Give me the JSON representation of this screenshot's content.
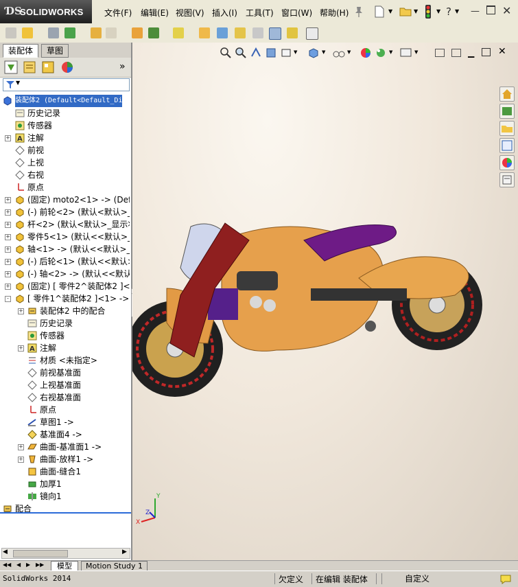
{
  "app": {
    "logo": "SOLIDWORKS",
    "status_version": "SolidWorks 2014"
  },
  "menu": [
    "文件(F)",
    "编辑(E)",
    "视图(V)",
    "插入(I)",
    "工具(T)",
    "窗口(W)",
    "帮助(H)"
  ],
  "panel_tabs": [
    "装配体",
    "草图"
  ],
  "tree": [
    {
      "label": "装配体2  (Default<Default_Di",
      "icon": "assembly-icon",
      "level": 0,
      "expander": ""
    },
    {
      "label": "历史记录",
      "icon": "history-icon",
      "level": 1,
      "expander": ""
    },
    {
      "label": "传感器",
      "icon": "sensor-icon",
      "level": 1,
      "expander": ""
    },
    {
      "label": "注解",
      "icon": "annotation-icon",
      "level": 1,
      "expander": "+"
    },
    {
      "label": "前视",
      "icon": "plane-icon",
      "level": 1,
      "expander": ""
    },
    {
      "label": "上视",
      "icon": "plane-icon",
      "level": 1,
      "expander": ""
    },
    {
      "label": "右视",
      "icon": "plane-icon",
      "level": 1,
      "expander": ""
    },
    {
      "label": "原点",
      "icon": "origin-icon",
      "level": 1,
      "expander": ""
    },
    {
      "label": "(固定) moto2<1> -> (Defau",
      "icon": "part-icon",
      "level": 1,
      "expander": "+"
    },
    {
      "label": "(-) 前轮<2> (默认<默认>_",
      "icon": "part-icon",
      "level": 1,
      "expander": "+"
    },
    {
      "label": "杆<2> (默认<默认>_显示状",
      "icon": "part-icon",
      "level": 1,
      "expander": "+"
    },
    {
      "label": "零件5<1> (默认<<默认>_外",
      "icon": "part-icon",
      "level": 1,
      "expander": "+"
    },
    {
      "label": "轴<1> -> (默认<<默认>_显",
      "icon": "part-icon",
      "level": 1,
      "expander": "+"
    },
    {
      "label": "(-) 后轮<1> (默认<<默认>_",
      "icon": "part-icon",
      "level": 1,
      "expander": "+"
    },
    {
      "label": "(-) 轴<2> -> (默认<<默认>_",
      "icon": "part-icon",
      "level": 1,
      "expander": "+"
    },
    {
      "label": "(固定) [ 零件2^装配体2 ]<",
      "icon": "part-icon",
      "level": 1,
      "expander": "+"
    },
    {
      "label": "[ 零件1^装配体2 ]<1> ->",
      "icon": "part-icon",
      "level": 1,
      "expander": "-"
    },
    {
      "label": "装配体2 中的配合",
      "icon": "mates-icon",
      "level": 2,
      "expander": "+"
    },
    {
      "label": "历史记录",
      "icon": "history-icon",
      "level": 2,
      "expander": ""
    },
    {
      "label": "传感器",
      "icon": "sensor-icon",
      "level": 2,
      "expander": ""
    },
    {
      "label": "注解",
      "icon": "annotation-icon",
      "level": 2,
      "expander": "+"
    },
    {
      "label": "材质 <未指定>",
      "icon": "material-icon",
      "level": 2,
      "expander": ""
    },
    {
      "label": "前视基准面",
      "icon": "plane-icon",
      "level": 2,
      "expander": ""
    },
    {
      "label": "上视基准面",
      "icon": "plane-icon",
      "level": 2,
      "expander": ""
    },
    {
      "label": "右视基准面",
      "icon": "plane-icon",
      "level": 2,
      "expander": ""
    },
    {
      "label": "原点",
      "icon": "origin-icon",
      "level": 2,
      "expander": ""
    },
    {
      "label": "草图1 ->",
      "icon": "sketch-icon",
      "level": 2,
      "expander": ""
    },
    {
      "label": "基准面4 ->",
      "icon": "plane-yellow-icon",
      "level": 2,
      "expander": ""
    },
    {
      "label": "曲面-基准面1 ->",
      "icon": "surface-icon",
      "level": 2,
      "expander": "+"
    },
    {
      "label": "曲面-放样1 ->",
      "icon": "loft-icon",
      "level": 2,
      "expander": "+"
    },
    {
      "label": "曲面-缝合1",
      "icon": "knit-icon",
      "level": 2,
      "expander": ""
    },
    {
      "label": "加厚1",
      "icon": "thicken-icon",
      "level": 2,
      "expander": ""
    },
    {
      "label": "镜向1",
      "icon": "mirror-icon",
      "level": 2,
      "expander": ""
    },
    {
      "label": "配合",
      "icon": "mates-icon",
      "level": 0,
      "expander": "+"
    }
  ],
  "bottom_tabs": [
    "模型",
    "Motion Study 1"
  ],
  "status": {
    "defined": "欠定义",
    "editing": "在编辑 装配体",
    "custom": "自定义"
  },
  "triad": {
    "x": "X",
    "y": "Y",
    "z": "Z"
  },
  "colors": {
    "body": "#e8a14a",
    "seat": "#6a1a7a",
    "frame": "#8a1e1e",
    "accent": "#2a5db0"
  }
}
